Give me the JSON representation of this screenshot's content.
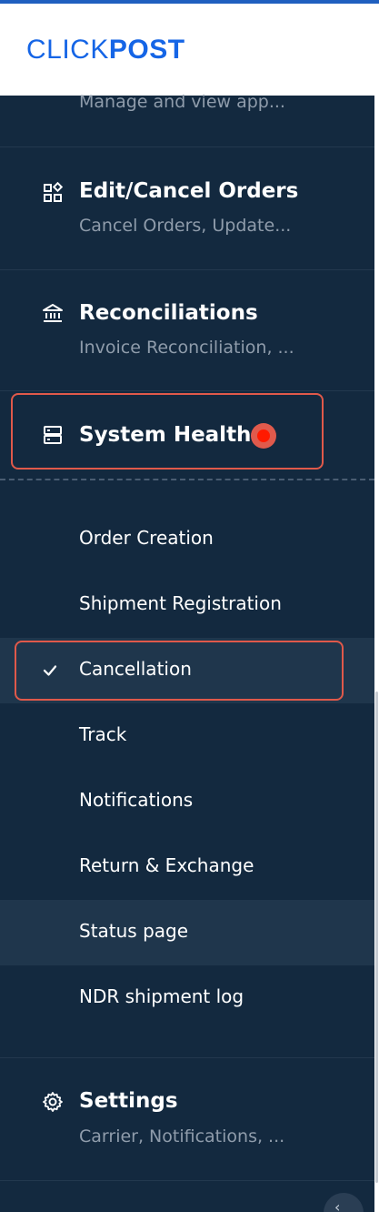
{
  "brand": {
    "logo_thin": "CLICK",
    "logo_bold": "POST"
  },
  "nav": {
    "partial_subtitle": "Manage and view app...",
    "edit_cancel": {
      "title": "Edit/Cancel Orders",
      "subtitle": "Cancel Orders, Update..."
    },
    "reconciliations": {
      "title": "Reconciliations",
      "subtitle": "Invoice Reconciliation, ..."
    },
    "system_health": {
      "title": "System Health",
      "items": [
        "Order Creation",
        "Shipment Registration",
        "Cancellation",
        "Track",
        "Notifications",
        "Return & Exchange",
        "Status page",
        "NDR shipment log"
      ],
      "selected_item": "Cancellation",
      "hovered_item": "Status page"
    },
    "settings": {
      "title": "Settings",
      "subtitle": "Carrier, Notifications, ..."
    }
  },
  "icons": {
    "edit_cancel": "widgets-icon",
    "reconciliations": "bank-icon",
    "system_health": "server-icon",
    "settings": "gear-icon",
    "selected": "check-icon",
    "collapse": "chevron-left-icon"
  },
  "colors": {
    "sidebar_bg": "#13293f",
    "highlight_bg": "#1f364c",
    "brand_blue": "#1565e6",
    "annotation_red": "#e0594a",
    "alert_red": "#ff1a00",
    "muted_text": "#8f9cab"
  }
}
